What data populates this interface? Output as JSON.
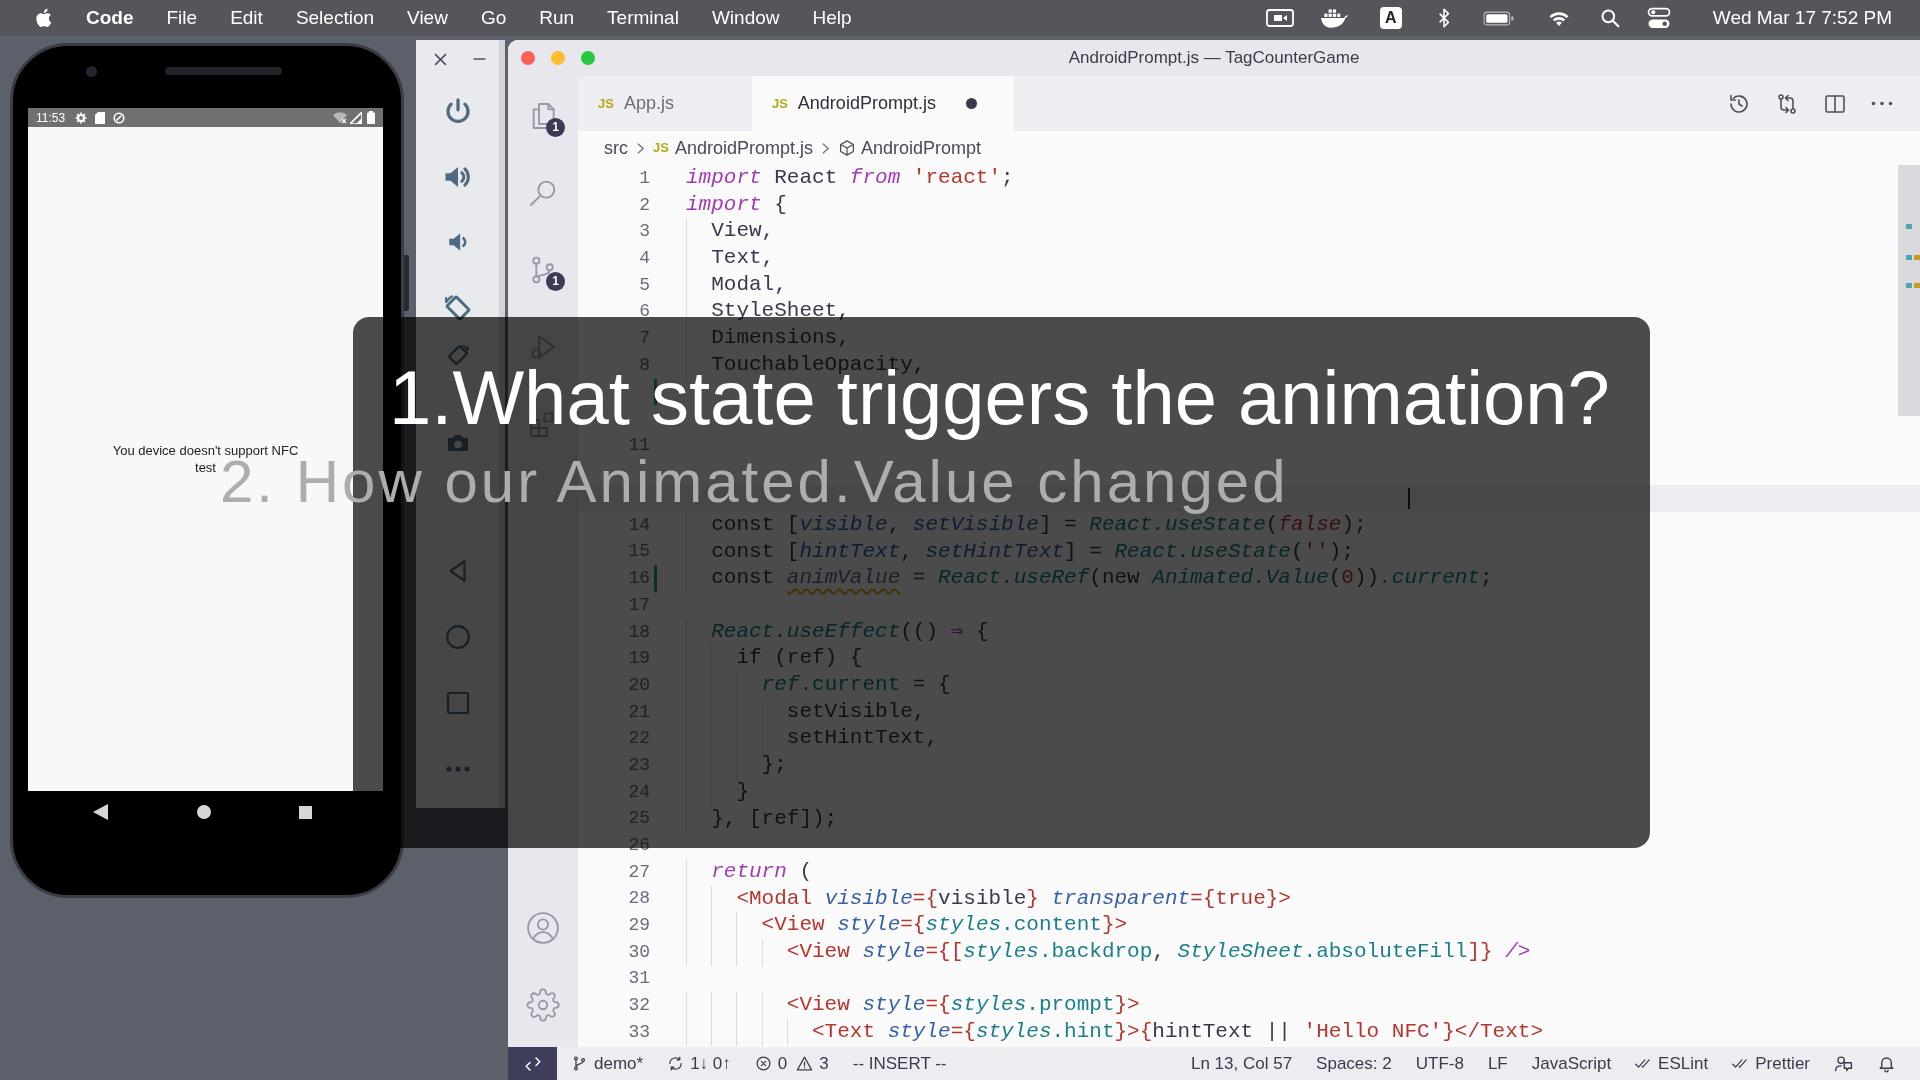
{
  "menu_bar": {
    "app": "Code",
    "items": [
      "File",
      "Edit",
      "Selection",
      "View",
      "Go",
      "Run",
      "Terminal",
      "Window",
      "Help"
    ],
    "input_source": "A",
    "clock": "Wed Mar 17 7:52 PM"
  },
  "phone": {
    "status_time": "11:53",
    "message_lines": [
      "You device doesn't support NFC",
      "test"
    ]
  },
  "editor": {
    "title": "AndroidPrompt.js — TagCounterGame",
    "activity_bar": [
      {
        "kind": "explorer",
        "badge": "1"
      },
      {
        "kind": "search"
      },
      {
        "kind": "source-control",
        "badge": "1"
      },
      {
        "kind": "run"
      },
      {
        "kind": "extensions"
      }
    ],
    "tabs": [
      {
        "label": "App.js",
        "file_type": "JS",
        "selected": false,
        "unsaved": false
      },
      {
        "label": "AndroidPrompt.js",
        "file_type": "JS",
        "selected": true,
        "unsaved": true
      }
    ],
    "breadcrumbs": [
      {
        "kind": "folder",
        "label": "src"
      },
      {
        "kind": "file",
        "file_type": "JS",
        "label": "AndroidPrompt.js"
      },
      {
        "kind": "symbol",
        "label": "AndroidPrompt"
      }
    ],
    "code_lines": [
      {
        "number": "1",
        "modified": false,
        "current": false,
        "tokens": [
          {
            "kind": "kw",
            "text": "import"
          },
          {
            "kind": "pl",
            "text": " React "
          },
          {
            "kind": "kw",
            "text": "from "
          },
          {
            "kind": "str",
            "text": "'react'"
          },
          {
            "kind": "pl",
            "text": ";"
          }
        ]
      },
      {
        "number": "2",
        "modified": false,
        "current": false,
        "tokens": [
          {
            "kind": "kw",
            "text": "import"
          },
          {
            "kind": "pl",
            "text": " {"
          }
        ]
      },
      {
        "number": "3",
        "modified": false,
        "current": false,
        "tokens": [
          {
            "kind": "pl",
            "text": "  View,"
          }
        ]
      },
      {
        "number": "4",
        "modified": false,
        "current": false,
        "tokens": [
          {
            "kind": "pl",
            "text": "  Text,"
          }
        ]
      },
      {
        "number": "5",
        "modified": false,
        "current": false,
        "tokens": [
          {
            "kind": "pl",
            "text": "  Modal,"
          }
        ]
      },
      {
        "number": "6",
        "modified": false,
        "current": false,
        "tokens": [
          {
            "kind": "pl",
            "text": "  StyleSheet,"
          }
        ]
      },
      {
        "number": "7",
        "modified": false,
        "current": false,
        "tokens": [
          {
            "kind": "pl",
            "text": "  Dimensions,"
          }
        ]
      },
      {
        "number": "8",
        "modified": false,
        "current": false,
        "tokens": [
          {
            "kind": "pl",
            "text": "  TouchableOpacity,"
          }
        ]
      },
      {
        "modified": true,
        "current": false
      },
      {
        "modified": false,
        "current": false
      },
      {
        "number": "11",
        "modified": false,
        "current": false
      },
      {
        "modified": false,
        "current": false
      },
      {
        "modified": false,
        "current": true
      },
      {
        "number": "14",
        "modified": false,
        "current": false,
        "tokens": [
          {
            "kind": "pl",
            "text": "  const ["
          },
          {
            "kind": "var",
            "text": "visible"
          },
          {
            "kind": "pl",
            "text": ", "
          },
          {
            "kind": "var",
            "text": "setVisible"
          },
          {
            "kind": "pl",
            "text": "] = "
          },
          {
            "kind": "fn",
            "text": "React.useState"
          },
          {
            "kind": "pl",
            "text": "("
          },
          {
            "kind": "bool",
            "text": "false"
          },
          {
            "kind": "pl",
            "text": ");"
          }
        ]
      },
      {
        "number": "15",
        "modified": false,
        "current": false,
        "tokens": [
          {
            "kind": "pl",
            "text": "  const ["
          },
          {
            "kind": "var",
            "text": "hintText"
          },
          {
            "kind": "pl",
            "text": ", "
          },
          {
            "kind": "var",
            "text": "setHintText"
          },
          {
            "kind": "pl",
            "text": "] = "
          },
          {
            "kind": "fn",
            "text": "React.useState"
          },
          {
            "kind": "pl",
            "text": "("
          },
          {
            "kind": "str",
            "text": "''"
          },
          {
            "kind": "pl",
            "text": ");"
          }
        ]
      },
      {
        "number": "16",
        "modified": true,
        "current": false,
        "tokens": [
          {
            "kind": "pl",
            "text": "  const "
          },
          {
            "kind": "unused",
            "text": "animValue"
          },
          {
            "kind": "pl",
            "text": " = "
          },
          {
            "kind": "fn",
            "text": "React.useRef"
          },
          {
            "kind": "pl",
            "text": "(new "
          },
          {
            "kind": "fn",
            "text": "Animated.Value"
          },
          {
            "kind": "pl",
            "text": "("
          },
          {
            "kind": "num",
            "text": "0"
          },
          {
            "kind": "pl",
            "text": "))"
          },
          {
            "kind": "fn",
            "text": ".current"
          },
          {
            "kind": "pl",
            "text": ";"
          }
        ]
      },
      {
        "number": "17",
        "modified": false,
        "current": false
      },
      {
        "number": "18",
        "modified": false,
        "current": false,
        "tokens": [
          {
            "kind": "fn",
            "text": "  React.useEffect"
          },
          {
            "kind": "pl",
            "text": "(() "
          },
          {
            "kind": "kw",
            "text": "⇒"
          },
          {
            "kind": "pl",
            "text": " {"
          }
        ]
      },
      {
        "number": "19",
        "modified": false,
        "current": false,
        "tokens": [
          {
            "kind": "pl",
            "text": "    if (ref) {"
          }
        ]
      },
      {
        "number": "20",
        "modified": false,
        "current": false,
        "tokens": [
          {
            "kind": "fn",
            "text": "      ref"
          },
          {
            "kind": "mem",
            "text": ".current"
          },
          {
            "kind": "pl",
            "text": " = {"
          }
        ]
      },
      {
        "number": "21",
        "modified": false,
        "current": false,
        "tokens": [
          {
            "kind": "pl",
            "text": "        setVisible,"
          }
        ]
      },
      {
        "number": "22",
        "modified": false,
        "current": false,
        "tokens": [
          {
            "kind": "pl",
            "text": "        setHintText,"
          }
        ]
      },
      {
        "number": "23",
        "modified": false,
        "current": false,
        "tokens": [
          {
            "kind": "pl",
            "text": "      };"
          }
        ]
      },
      {
        "number": "24",
        "modified": false,
        "current": false,
        "tokens": [
          {
            "kind": "pl",
            "text": "    }"
          }
        ]
      },
      {
        "number": "25",
        "modified": false,
        "current": false,
        "tokens": [
          {
            "kind": "pl",
            "text": "  }, [ref]);"
          }
        ]
      },
      {
        "number": "26",
        "modified": false,
        "current": false
      },
      {
        "number": "27",
        "modified": false,
        "current": false,
        "tokens": [
          {
            "kind": "kw",
            "text": "  return"
          },
          {
            "kind": "pl",
            "text": " ("
          }
        ]
      },
      {
        "number": "28",
        "modified": false,
        "current": false,
        "tokens": [
          {
            "kind": "tag",
            "text": "    <Modal"
          },
          {
            "kind": "attr",
            "text": " visible"
          },
          {
            "kind": "tag",
            "text": "={"
          },
          {
            "kind": "pl",
            "text": "visible"
          },
          {
            "kind": "tag",
            "text": "}"
          },
          {
            "kind": "attr",
            "text": " transparent"
          },
          {
            "kind": "tag",
            "text": "={true}>"
          }
        ]
      },
      {
        "number": "29",
        "modified": false,
        "current": false,
        "tokens": [
          {
            "kind": "tag",
            "text": "      <View"
          },
          {
            "kind": "attr",
            "text": " style"
          },
          {
            "kind": "tag",
            "text": "={"
          },
          {
            "kind": "fn",
            "text": "styles"
          },
          {
            "kind": "mem",
            "text": ".content"
          },
          {
            "kind": "tag",
            "text": "}>"
          }
        ]
      },
      {
        "number": "30",
        "modified": false,
        "current": false,
        "tokens": [
          {
            "kind": "tag",
            "text": "        <View"
          },
          {
            "kind": "attr",
            "text": " style"
          },
          {
            "kind": "tag",
            "text": "={["
          },
          {
            "kind": "fn",
            "text": "styles"
          },
          {
            "kind": "mem",
            "text": ".backdrop"
          },
          {
            "kind": "pl",
            "text": ", "
          },
          {
            "kind": "fn",
            "text": "StyleSheet"
          },
          {
            "kind": "mem",
            "text": ".absoluteFill"
          },
          {
            "kind": "tag",
            "text": "]}"
          },
          {
            "kind": "kw",
            "text": " />"
          }
        ]
      },
      {
        "number": "31",
        "modified": false,
        "current": false
      },
      {
        "number": "32",
        "modified": false,
        "current": false,
        "tokens": [
          {
            "kind": "tag",
            "text": "        <View"
          },
          {
            "kind": "attr",
            "text": " style"
          },
          {
            "kind": "tag",
            "text": "={"
          },
          {
            "kind": "fn",
            "text": "styles"
          },
          {
            "kind": "mem",
            "text": ".prompt"
          },
          {
            "kind": "tag",
            "text": "}>"
          }
        ]
      },
      {
        "number": "33",
        "modified": false,
        "current": false,
        "tokens": [
          {
            "kind": "tag",
            "text": "          <Text"
          },
          {
            "kind": "attr",
            "text": " style"
          },
          {
            "kind": "tag",
            "text": "={"
          },
          {
            "kind": "fn",
            "text": "styles"
          },
          {
            "kind": "mem",
            "text": ".hint"
          },
          {
            "kind": "tag",
            "text": "}>{"
          },
          {
            "kind": "pl",
            "text": "hintText || "
          },
          {
            "kind": "str",
            "text": "'Hello NFC'"
          },
          {
            "kind": "tag",
            "text": "}</Text>"
          }
        ]
      }
    ]
  },
  "status_bar": {
    "left": [
      {
        "kind": "branch",
        "text": "demo*"
      },
      {
        "kind": "sync",
        "text": "1↓ 0↑"
      },
      {
        "kind": "errors",
        "text": "0"
      },
      {
        "kind": "warnings",
        "text": "3"
      },
      {
        "kind": "mode",
        "text": "-- INSERT --"
      }
    ],
    "right": [
      {
        "kind": "cursor",
        "text": "Ln 13, Col 57"
      },
      {
        "kind": "plain",
        "text": "Spaces: 2"
      },
      {
        "kind": "plain",
        "text": "UTF-8"
      },
      {
        "kind": "plain",
        "text": "LF"
      },
      {
        "kind": "plain",
        "text": "JavaScript"
      },
      {
        "kind": "linter",
        "text": "ESLint"
      },
      {
        "kind": "linter",
        "text": "Prettier"
      },
      {
        "kind": "feedback"
      },
      {
        "kind": "bell"
      }
    ]
  },
  "overlay": {
    "questions": [
      {
        "text": "1.What state triggers the animation?",
        "faded": false
      },
      {
        "text": "2. How our Animated.Value changed",
        "faded": true
      }
    ]
  }
}
